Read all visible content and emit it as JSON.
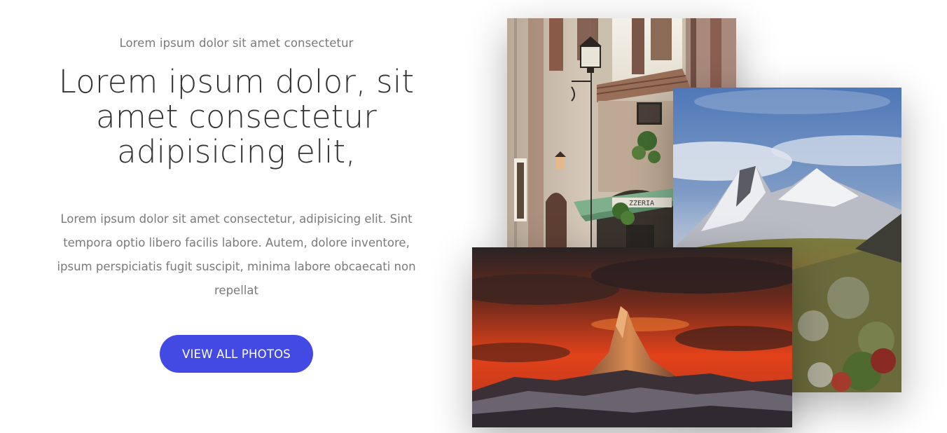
{
  "hero": {
    "eyebrow": "Lorem ipsum dolor sit amet consectetur",
    "headline_lines": [
      "Lorem ipsum dolor, sit",
      "amet consectetur",
      "adipisicing elit,"
    ],
    "body_text": "Lorem ipsum dolor sit amet consectetur, adipisicing elit. Sint tempora optio libero facilis labore. Autem, dolore inventore, ipsum perspiciatis fugit suscipit, minima labore obcaecati non repellat",
    "cta_label": "VIEW ALL PHOTOS"
  },
  "gallery": {
    "alley_photo": {
      "sign_text": "ZZERIA"
    }
  },
  "colors": {
    "cta_background": "#4349e3",
    "heading_text": "#333333",
    "muted_text": "#7a7a7a"
  }
}
